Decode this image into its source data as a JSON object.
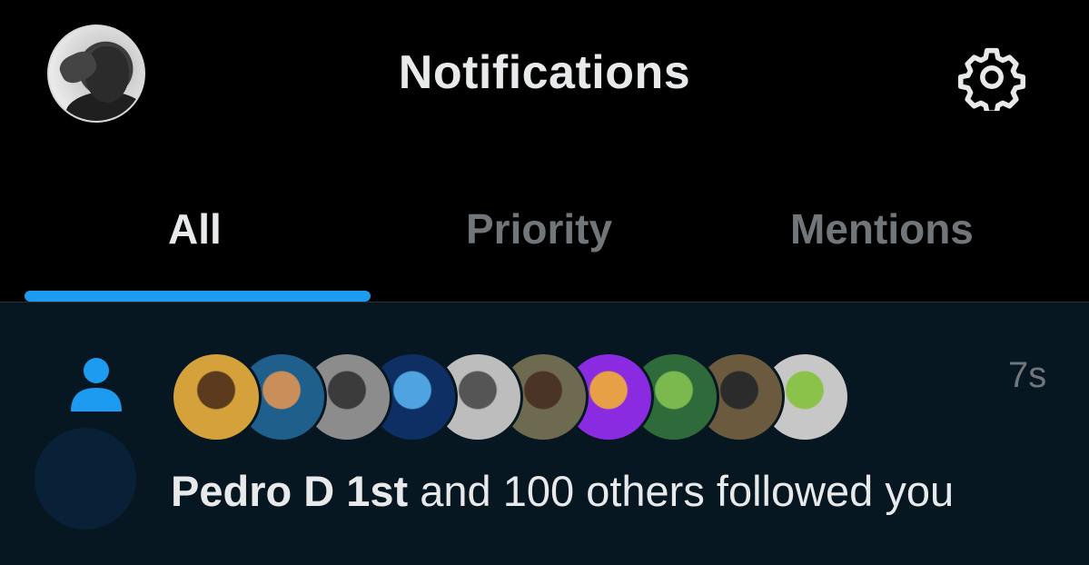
{
  "header": {
    "title": "Notifications",
    "profile_icon": "profile-avatar",
    "settings_icon": "gear-icon"
  },
  "tabs": [
    {
      "label": "All",
      "active": true
    },
    {
      "label": "Priority",
      "active": false
    },
    {
      "label": "Mentions",
      "active": false
    }
  ],
  "notification": {
    "type_icon": "person-follow-icon",
    "actor": "Pedro D 1st",
    "rest": " and 100 others followed you",
    "time": "7s",
    "avatars": [
      {
        "name": "follower-1",
        "bg": "#d4a13a",
        "fg": "#5b3a1e"
      },
      {
        "name": "follower-2",
        "bg": "#1f5f8b",
        "fg": "#c98e5a"
      },
      {
        "name": "follower-3",
        "bg": "#8c8c8c",
        "fg": "#3b3b3b"
      },
      {
        "name": "follower-4",
        "bg": "#0d2f63",
        "fg": "#4fa3e0"
      },
      {
        "name": "follower-5",
        "bg": "#bdbdbd",
        "fg": "#555555"
      },
      {
        "name": "follower-6",
        "bg": "#6d6a4f",
        "fg": "#4a3426"
      },
      {
        "name": "follower-7",
        "bg": "#8a2be2",
        "fg": "#e8a046"
      },
      {
        "name": "follower-8",
        "bg": "#2f6b3a",
        "fg": "#7bb84e"
      },
      {
        "name": "follower-9",
        "bg": "#6b5a3e",
        "fg": "#2b2b2b"
      },
      {
        "name": "follower-10",
        "bg": "#c7c7c7",
        "fg": "#8bc34a"
      }
    ]
  },
  "colors": {
    "accent": "#1d9bf0",
    "background": "#000000",
    "notif_bg": "#061722",
    "muted": "#71767b",
    "text": "#e7e9ea"
  }
}
